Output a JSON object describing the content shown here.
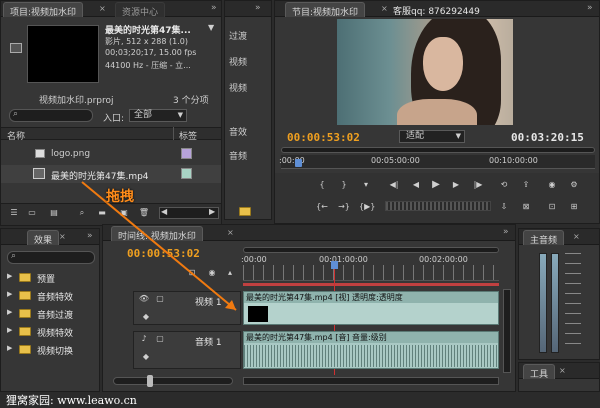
{
  "project_panel": {
    "tab_title": "项目:视频加水印",
    "tab_resource": "资源中心",
    "clip_name": "最美的时光第47集...",
    "clip_type": "影片, 512 x 288 (1.0)",
    "clip_duration": "00;03;20;17, 15.00 fps",
    "clip_audio": "44100 Hz - 压缩 - 立...",
    "project_file": "视频加水印.prproj",
    "item_count": "3 个分项",
    "entry_label": "入口:",
    "entry_value": "全部",
    "col_name": "名称",
    "col_label": "标签",
    "items": [
      {
        "name": "logo.png",
        "label_color": "#b7a3d9"
      },
      {
        "name": "最美的时光第47集.mp4",
        "label_color": "#a9d4c5"
      }
    ]
  },
  "source_strip": {
    "tabs": [
      "过渡",
      "视频",
      "视频",
      "音效",
      "音频"
    ]
  },
  "program_panel": {
    "tab_title": "节目:视频加水印",
    "qq_text": "客服qq: 876292449",
    "current_time": "00:00:53:02",
    "fit_label": "适配",
    "total_time": "00:03:20:15",
    "ruler_labels": [
      ":00:00",
      "00:05:00:00",
      "00:10:00:00"
    ]
  },
  "effects_panel": {
    "tab_title": "效果",
    "folders": [
      "预置",
      "音频特效",
      "音频过渡",
      "视频特效",
      "视频切换"
    ]
  },
  "timeline_panel": {
    "tab_title": "时间线: 视频加水印",
    "current_time": "00:00:53:02",
    "ruler_labels": [
      ":00:00",
      "00:01:00:00",
      "00:02:00:00"
    ],
    "video_track": "视频 1",
    "audio_track": "音频 1",
    "video_clip": "最美的时光第47集.mp4 [视] 透明度:透明度",
    "audio_clip": "最美的时光第47集.mp4 [音] 音量:级别"
  },
  "master_audio": {
    "tab_title": "主音频"
  },
  "tools": {
    "tab_title": "工具"
  },
  "annotation": {
    "drag_label": "拖拽"
  },
  "watermark": {
    "text": "狸窝家园: www.leawo.cn"
  }
}
